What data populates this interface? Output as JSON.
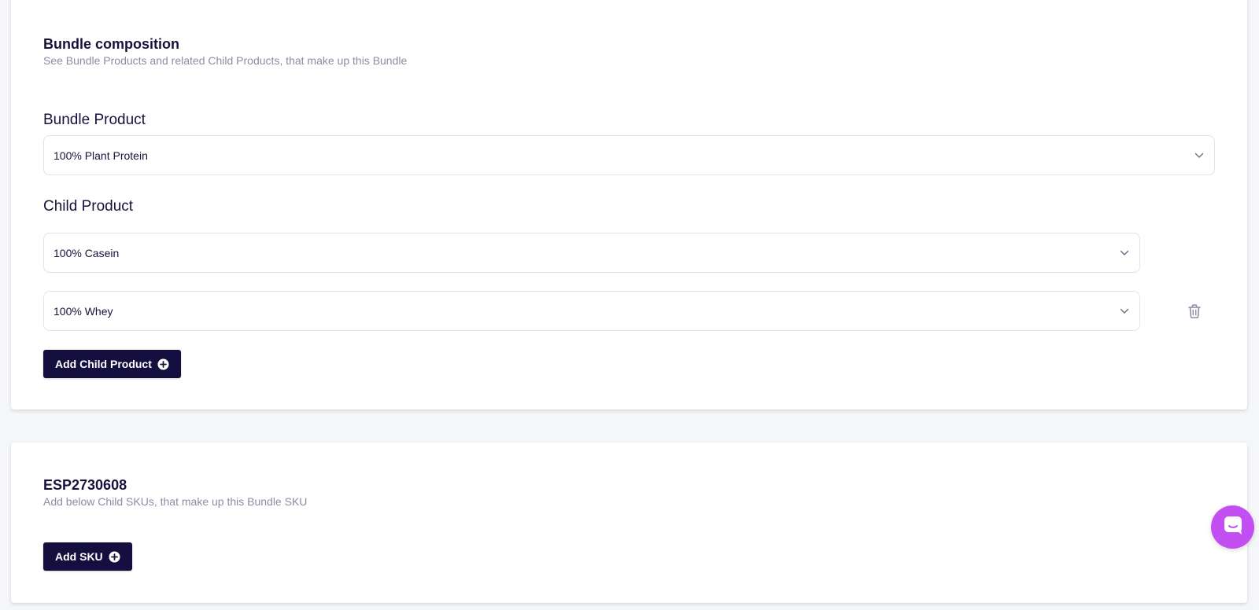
{
  "composition": {
    "title": "Bundle composition",
    "subtitle": "See Bundle Products and related Child Products, that make up this Bundle",
    "bundle_product_label": "Bundle Product",
    "bundle_product_value": "100% Plant Protein",
    "child_product_label": "Child Product",
    "child_products": [
      {
        "value": "100% Casein"
      },
      {
        "value": "100% Whey"
      }
    ],
    "add_child_button": "Add Child Product"
  },
  "sku_section": {
    "title": "ESP2730608",
    "subtitle": "Add below Child SKUs, that make up this Bundle SKU",
    "add_sku_button": "Add SKU"
  },
  "colors": {
    "primary": "#150f3f",
    "chat_accent": "#c34ff2",
    "muted_text": "#8d8ba6"
  },
  "icons": {
    "dropdown": "chevron-down-icon",
    "add": "plus-circle-icon",
    "delete": "trash-icon",
    "chat": "chat-icon"
  }
}
